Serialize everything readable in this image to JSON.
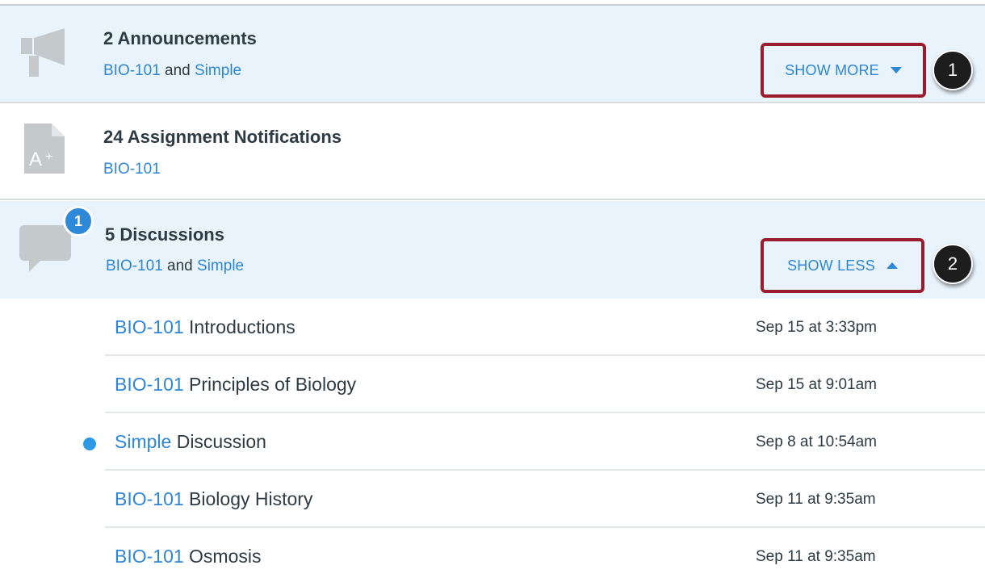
{
  "groups": {
    "announcements": {
      "icon": "megaphone-icon",
      "title": "2 Announcements",
      "course1": "BIO-101",
      "conjunction": "and",
      "course2": "Simple",
      "toggle_label": "SHOW MORE",
      "callout": "1"
    },
    "assignments": {
      "icon": "assignment-grade-icon",
      "title": "24 Assignment Notifications",
      "course1": "BIO-101"
    },
    "discussions": {
      "icon": "discussion-bubble-icon",
      "badge": "1",
      "title": "5 Discussions",
      "course1": "BIO-101",
      "conjunction": "and",
      "course2": "Simple",
      "toggle_label": "SHOW LESS",
      "callout": "2"
    }
  },
  "discussion_items": [
    {
      "course": "BIO-101",
      "title": "Introductions",
      "date": "Sep 15 at 3:33pm",
      "unread": false
    },
    {
      "course": "BIO-101",
      "title": "Principles of Biology",
      "date": "Sep 15 at 9:01am",
      "unread": false
    },
    {
      "course": "Simple",
      "title": "Discussion",
      "date": "Sep 8 at 10:54am",
      "unread": true
    },
    {
      "course": "BIO-101",
      "title": "Biology History",
      "date": "Sep 11 at 9:35am",
      "unread": false
    },
    {
      "course": "BIO-101",
      "title": "Osmosis",
      "date": "Sep 11 at 9:35am",
      "unread": false
    }
  ],
  "colors": {
    "link": "#2e86d6",
    "row_highlight": "#e9f3fc",
    "callout_outline": "#9b1c2c",
    "badge": "#2e8ad8",
    "unread_dot": "#2e9ae6"
  }
}
